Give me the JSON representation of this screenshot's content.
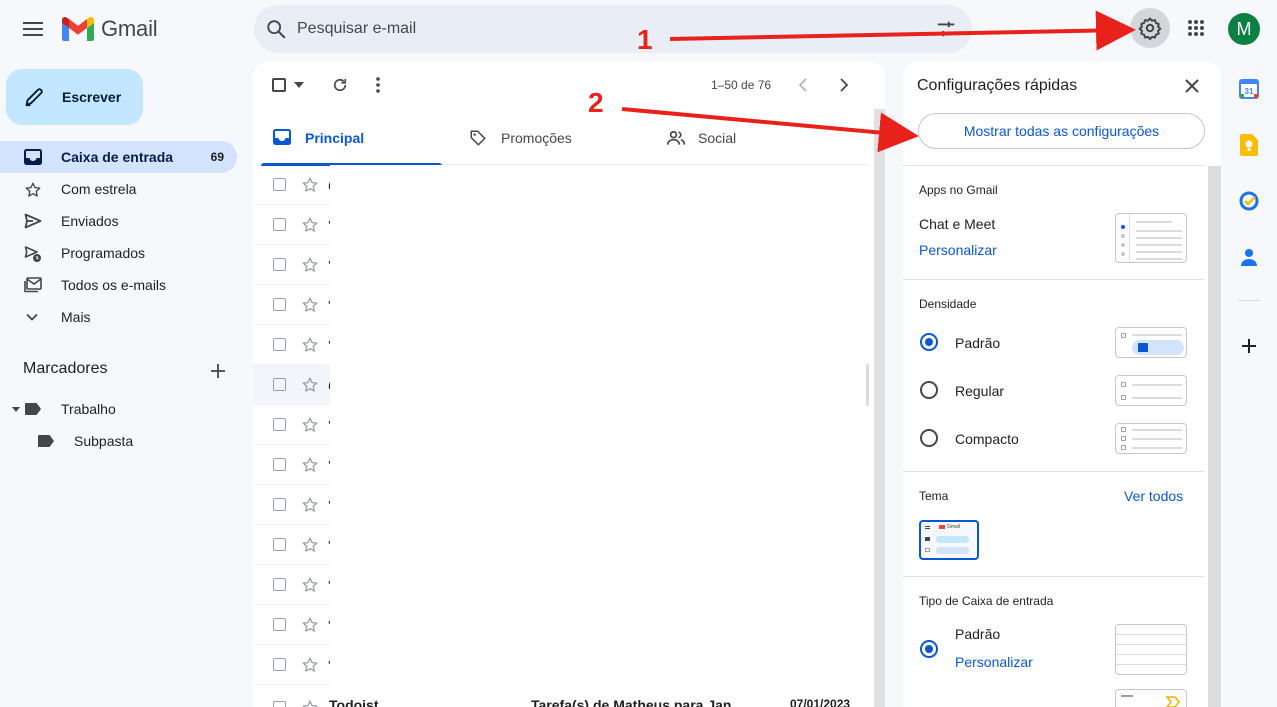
{
  "app": {
    "name": "Gmail"
  },
  "search": {
    "placeholder": "Pesquisar e-mail"
  },
  "account": {
    "initial": "M"
  },
  "compose": {
    "label": "Escrever"
  },
  "nav": {
    "items": [
      {
        "label": "Caixa de entrada",
        "count": "69",
        "icon": "inbox-icon",
        "active": true
      },
      {
        "label": "Com estrela",
        "icon": "star-icon"
      },
      {
        "label": "Enviados",
        "icon": "send-icon"
      },
      {
        "label": "Programados",
        "icon": "scheduled-icon"
      },
      {
        "label": "Todos os e-mails",
        "icon": "all-mail-icon"
      },
      {
        "label": "Mais",
        "icon": "chevron-down-icon"
      }
    ],
    "labels_title": "Marcadores",
    "labels": [
      {
        "label": "Trabalho",
        "icon": "label-icon"
      },
      {
        "label": "Subpasta",
        "icon": "label-icon"
      }
    ]
  },
  "toolbar": {
    "pagination": "1–50 de 76"
  },
  "tabs": [
    {
      "label": "Principal",
      "icon": "inbox-icon",
      "active": true
    },
    {
      "label": "Promoções",
      "icon": "tag-icon"
    },
    {
      "label": "Social",
      "icon": "people-icon"
    }
  ],
  "emails": {
    "fragments": [
      "(",
      "’",
      "’",
      "'",
      "’",
      "(",
      "’",
      "’",
      "’",
      "'",
      "'",
      "'",
      "'"
    ],
    "last": {
      "sender": "Todoist",
      "subject": "Tarefa(s) de Matheus para Jan",
      "date": "07/01/2023"
    }
  },
  "quick_settings": {
    "title": "Configurações rápidas",
    "show_all": "Mostrar todas as configurações",
    "apps": {
      "heading": "Apps no Gmail",
      "item": "Chat e Meet",
      "link": "Personalizar"
    },
    "density": {
      "heading": "Densidade",
      "options": [
        {
          "label": "Padrão",
          "selected": true
        },
        {
          "label": "Regular",
          "selected": false
        },
        {
          "label": "Compacto",
          "selected": false
        }
      ]
    },
    "theme": {
      "heading": "Tema",
      "link": "Ver todos",
      "mini_logo": "Gmail"
    },
    "inbox_type": {
      "heading": "Tipo de Caixa de entrada",
      "option": "Padrão",
      "selected": true,
      "link": "Personalizar"
    }
  },
  "annotations": {
    "step1": "1",
    "step2": "2",
    "arrow_color": "#e8221b"
  },
  "colors": {
    "accent": "#0b57d0",
    "compose_bg": "#c2e7ff",
    "active_nav": "#d3e3fd",
    "avatar": "#0b8043"
  }
}
